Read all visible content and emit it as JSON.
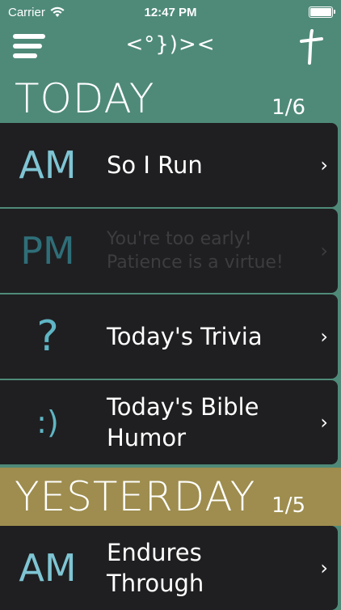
{
  "status_bar": {
    "carrier": "Carrier",
    "time": "12:47 PM",
    "battery_level": 1.0
  },
  "nav": {
    "logo": "<°})><",
    "menu_icon": "hamburger-icon",
    "cross_icon": "cross-icon"
  },
  "sections": [
    {
      "title": "TODAY",
      "count": "1/6",
      "color": "#4f8a79",
      "items": [
        {
          "icon": "AM",
          "text": "So I Run",
          "enabled": true
        },
        {
          "icon": "PM",
          "text": "You're too early!\nPatience is a virtue!",
          "enabled": false
        },
        {
          "icon": "?",
          "text": "Today's Trivia",
          "enabled": true
        },
        {
          "icon": ":)",
          "text": "Today's Bible\nHumor",
          "enabled": true
        }
      ]
    },
    {
      "title": "YESTERDAY",
      "count": "1/5",
      "color": "#9e8d4e",
      "items": [
        {
          "icon": "AM",
          "text": "Endures\nThrough",
          "enabled": true
        }
      ]
    }
  ],
  "colors": {
    "accent": "#7fc5d4",
    "dim_icon": "#2f6e78",
    "card": "#1f1f21"
  }
}
